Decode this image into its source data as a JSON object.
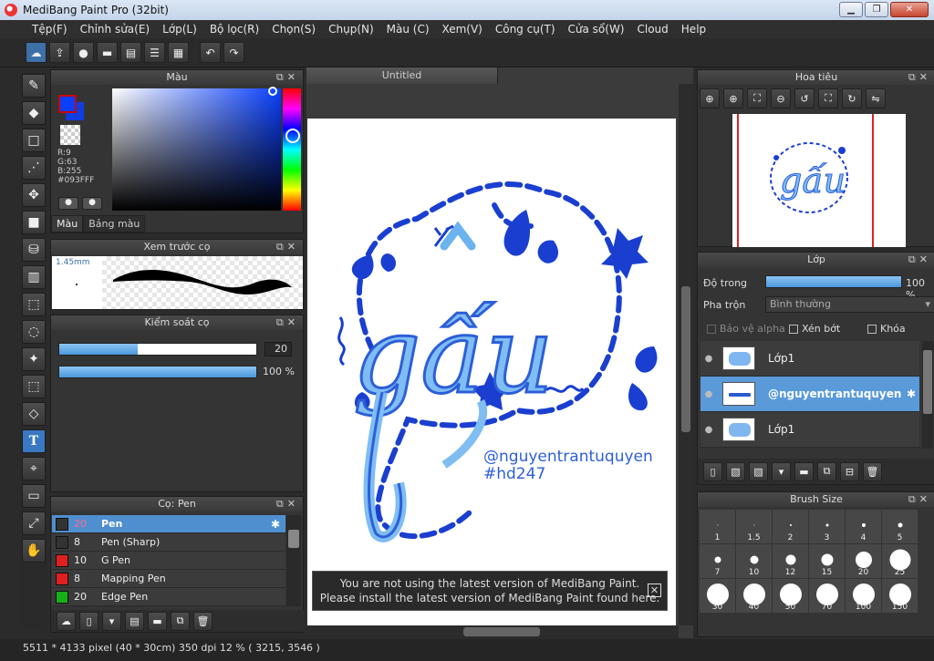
{
  "window": {
    "title": "MediBang Paint Pro (32bit)",
    "minimize": "▁",
    "maximize": "❐",
    "close": "✕"
  },
  "menu": [
    "Tệp(F)",
    "Chỉnh sửa(E)",
    "Lớp(L)",
    "Bộ lọc(R)",
    "Chọn(S)",
    "Chụp(N)",
    "Màu (C)",
    "Xem(V)",
    "Công cụ(T)",
    "Cửa sổ(W)",
    "Cloud",
    "Help"
  ],
  "toolbar_icons": [
    "cloud-icon",
    "share-icon",
    "comment-icon",
    "chat-icon",
    "page-icon",
    "list-icon",
    "grid-icon",
    "undo-icon",
    "redo-icon"
  ],
  "color_panel": {
    "title": "Màu",
    "r": "R:9",
    "g": "G:63",
    "b": "B:255",
    "hex": "#093FFF",
    "current_color": "#093FFF",
    "tab_color": "Màu",
    "tab_palette": "Bảng màu"
  },
  "brush_preview": {
    "title": "Xem trước cọ",
    "size": "1.45mm"
  },
  "brush_control": {
    "title": "Kiểm soát cọ",
    "size_value": "20",
    "size_fraction": 0.4,
    "opacity_value": "100 %",
    "opacity_fraction": 1.0
  },
  "brush_panel": {
    "title": "Cọ: Pen",
    "items": [
      {
        "num": "20",
        "name": "Pen",
        "color": "#333333",
        "active": true
      },
      {
        "num": "8",
        "name": "Pen (Sharp)",
        "color": "#333333",
        "active": false
      },
      {
        "num": "10",
        "name": "G Pen",
        "color": "#e02020",
        "active": false
      },
      {
        "num": "8",
        "name": "Mapping Pen",
        "color": "#e02020",
        "active": false
      },
      {
        "num": "20",
        "name": "Edge Pen",
        "color": "#18b018",
        "active": false
      }
    ]
  },
  "canvas": {
    "tab": "Untitled",
    "art_text": "gấu",
    "signature": "@nguyentrantuquyen",
    "hashtag": "#hd247",
    "notice_line1": "You are not using the latest version of MediBang Paint.",
    "notice_line2": "Please install the latest version of MediBang Paint found here.",
    "notice_close": "✕"
  },
  "navigator": {
    "title": "Hoa tiêu"
  },
  "layers": {
    "title": "Lớp",
    "opacity_label": "Độ trong",
    "opacity_value": "100 %",
    "blend_label": "Pha trộn",
    "blend_value": "Bình thường",
    "protect_alpha": "Bảo vệ alpha",
    "clipping": "Xén bớt",
    "lock": "Khóa",
    "items": [
      {
        "name": "Lớp1",
        "active": false
      },
      {
        "name": "@nguyentrantuquyen",
        "active": true
      },
      {
        "name": "Lớp1",
        "active": false
      }
    ]
  },
  "brush_size": {
    "title": "Brush Size",
    "sizes": [
      {
        "label": "1",
        "d": 1
      },
      {
        "label": "1.5",
        "d": 1
      },
      {
        "label": "2",
        "d": 2
      },
      {
        "label": "3",
        "d": 3
      },
      {
        "label": "4",
        "d": 4
      },
      {
        "label": "5",
        "d": 5
      },
      {
        "label": "7",
        "d": 7
      },
      {
        "label": "10",
        "d": 9
      },
      {
        "label": "12",
        "d": 11
      },
      {
        "label": "15",
        "d": 13
      },
      {
        "label": "20",
        "d": 18
      },
      {
        "label": "25",
        "d": 23
      },
      {
        "label": "30",
        "d": 24
      },
      {
        "label": "40",
        "d": 24
      },
      {
        "label": "50",
        "d": 24
      },
      {
        "label": "70",
        "d": 24
      },
      {
        "label": "100",
        "d": 24
      },
      {
        "label": "150",
        "d": 24
      }
    ]
  },
  "status": "5511 * 4133 pixel  (40 * 30cm)  350 dpi  12 %  ( 3215, 3546 )"
}
